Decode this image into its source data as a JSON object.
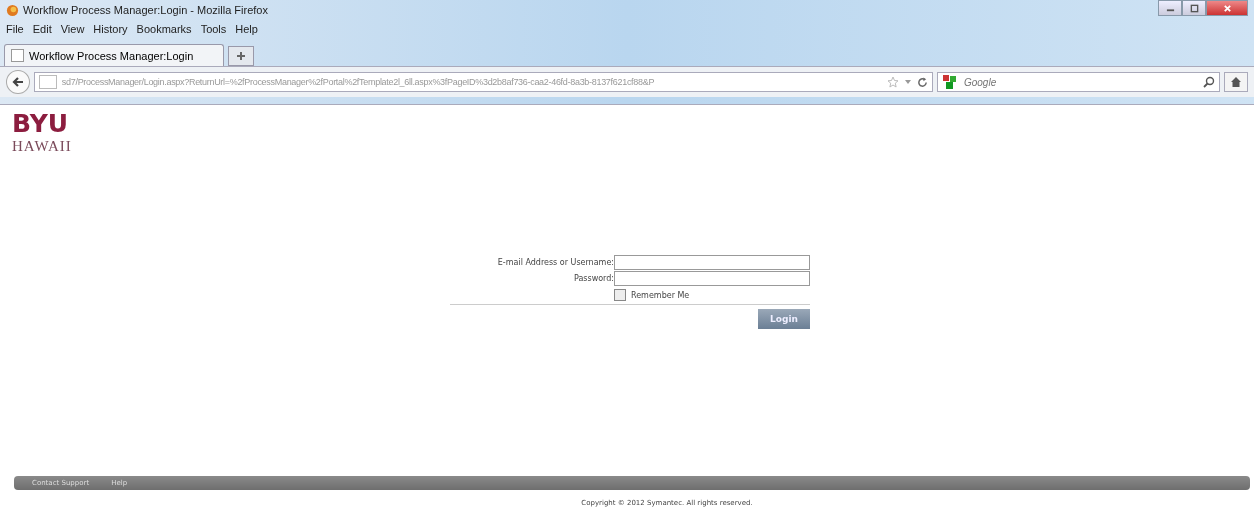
{
  "window": {
    "title": "Workflow Process Manager:Login - Mozilla Firefox"
  },
  "menu": [
    "File",
    "Edit",
    "View",
    "History",
    "Bookmarks",
    "Tools",
    "Help"
  ],
  "tabs": [
    {
      "label": "Workflow Process Manager:Login",
      "selected": true
    }
  ],
  "address_bar": {
    "url": "sd7/ProcessManager/Login.aspx?ReturnUrl=%2fProcessManager%2fPortal%2fTemplate2l_6ll.aspx%3fPageID%3d2b8af736-caa2-46fd-8a3b-8137f621cf88&P"
  },
  "search": {
    "placeholder": "Google"
  },
  "logo": {
    "line_1": "BYU",
    "line_2": "HAWAII"
  },
  "form": {
    "username_label": "E-mail Address or Username:",
    "password_label": "Password:",
    "remember": {
      "label": "Remember Me",
      "checked": false
    },
    "button": "Login"
  },
  "footer": {
    "links": [
      "Contact Support",
      "Help"
    ],
    "copyright": "Copyright © 2012 Symantec. All rights reserved."
  }
}
